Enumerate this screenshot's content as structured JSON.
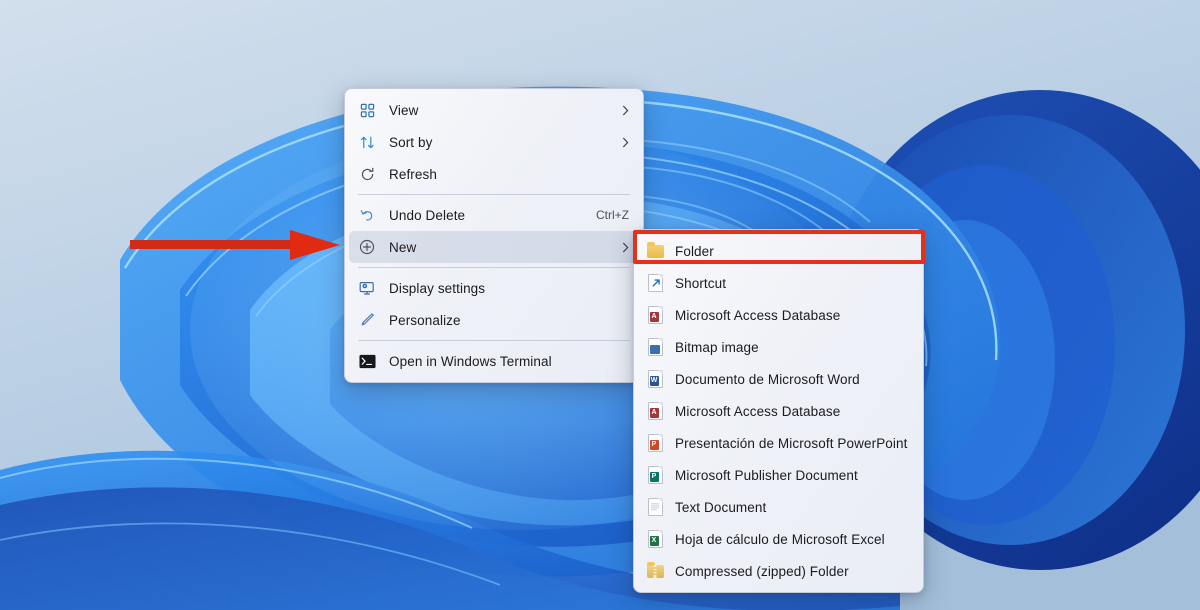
{
  "desktop": {
    "wallpaper_name": "windows-11-bloom-wallpaper",
    "background_top_color": "#cfdceb",
    "background_bottom_color": "#a6c0da",
    "petal_light_color": "#3ea0f5",
    "petal_mid_color": "#1f78e8",
    "petal_deep_color": "#1240b8"
  },
  "annotations": {
    "arrow": {
      "name": "red-pointer-arrow",
      "color": "#cf2b18",
      "points_to": "New"
    },
    "highlight_box": {
      "name": "red-highlight-box",
      "color": "#e5301a",
      "surrounds": "Folder"
    }
  },
  "context_menu": {
    "name": "desktop-context-menu",
    "groups": [
      {
        "items": [
          {
            "label": "View",
            "icon": "grid-icon",
            "accel": "",
            "submenu": true,
            "selected": false
          },
          {
            "label": "Sort by",
            "icon": "sort-icon",
            "accel": "",
            "submenu": true,
            "selected": false
          },
          {
            "label": "Refresh",
            "icon": "refresh-icon",
            "accel": "",
            "submenu": false,
            "selected": false
          }
        ]
      },
      {
        "items": [
          {
            "label": "Undo Delete",
            "icon": "undo-icon",
            "accel": "Ctrl+Z",
            "submenu": false,
            "selected": false
          },
          {
            "label": "New",
            "icon": "plus-circle-icon",
            "accel": "",
            "submenu": true,
            "selected": true
          }
        ]
      },
      {
        "items": [
          {
            "label": "Display settings",
            "icon": "monitor-gear-icon",
            "accel": "",
            "submenu": false,
            "selected": false
          },
          {
            "label": "Personalize",
            "icon": "paintbrush-icon",
            "accel": "",
            "submenu": false,
            "selected": false
          }
        ]
      },
      {
        "items": [
          {
            "label": "Open in Windows Terminal",
            "icon": "terminal-icon",
            "accel": "",
            "submenu": false,
            "selected": false
          }
        ]
      }
    ]
  },
  "new_submenu": {
    "name": "new-submenu",
    "items": [
      {
        "label": "Folder",
        "icon": "folder-icon",
        "tag": "",
        "tag_color": "",
        "highlighted": true
      },
      {
        "label": "Shortcut",
        "icon": "shortcut-icon",
        "tag": "",
        "tag_color": "",
        "highlighted": false
      },
      {
        "label": "Microsoft Access Database",
        "icon": "access-icon",
        "tag": "A",
        "tag_color": "#a4373a",
        "highlighted": false
      },
      {
        "label": "Bitmap image",
        "icon": "bitmap-icon",
        "tag": "",
        "tag_color": "#3b6fb5",
        "highlighted": false
      },
      {
        "label": "Documento de Microsoft Word",
        "icon": "word-icon",
        "tag": "W",
        "tag_color": "#2b579a",
        "highlighted": false
      },
      {
        "label": "Microsoft Access Database",
        "icon": "access-icon",
        "tag": "A",
        "tag_color": "#a4373a",
        "highlighted": false
      },
      {
        "label": "Presentación de Microsoft PowerPoint",
        "icon": "powerpoint-icon",
        "tag": "P",
        "tag_color": "#d24726",
        "highlighted": false
      },
      {
        "label": "Microsoft Publisher Document",
        "icon": "publisher-icon",
        "tag": "P",
        "tag_color": "#077568",
        "highlighted": false
      },
      {
        "label": "Text Document",
        "icon": "text-file-icon",
        "tag": "",
        "tag_color": "",
        "highlighted": false
      },
      {
        "label": "Hoja de cálculo de Microsoft Excel",
        "icon": "excel-icon",
        "tag": "X",
        "tag_color": "#217346",
        "highlighted": false
      },
      {
        "label": "Compressed (zipped) Folder",
        "icon": "zip-folder-icon",
        "tag": "",
        "tag_color": "",
        "highlighted": false
      }
    ]
  }
}
